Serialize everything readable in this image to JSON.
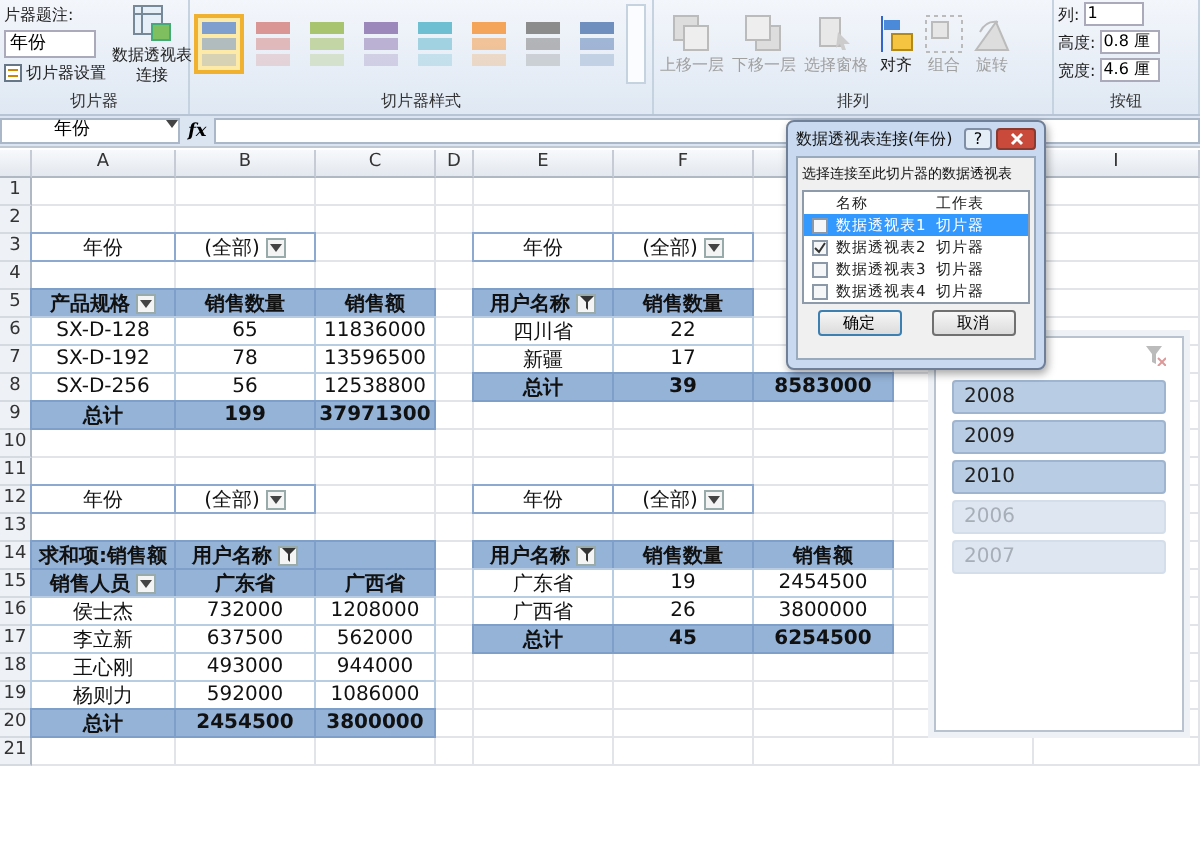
{
  "ribbon": {
    "slicer_group": {
      "caption_label": "片器题注:",
      "caption_value": "年份",
      "settings_button": "切片器设置",
      "connections_button": [
        "数据透视表",
        "连接"
      ],
      "label": "切片器"
    },
    "styles_group": {
      "styles": [
        {
          "color": "#7f9fcf",
          "selected": true
        },
        {
          "color": "#d99694",
          "selected": false
        },
        {
          "color": "#a9c46e",
          "selected": false
        },
        {
          "color": "#9c88bb",
          "selected": false
        },
        {
          "color": "#6fbfd3",
          "selected": false
        },
        {
          "color": "#f5a55a",
          "selected": false
        },
        {
          "color": "#8c8c8c",
          "selected": false
        },
        {
          "color": "#6f8fbf",
          "selected": false
        }
      ],
      "label": "切片器样式"
    },
    "arrange_group": {
      "buttons": [
        {
          "kind": "forward",
          "label": "上移一层",
          "disabled": true
        },
        {
          "kind": "backward",
          "label": "下移一层",
          "disabled": true
        },
        {
          "kind": "pane",
          "label": "选择窗格",
          "disabled": true
        },
        {
          "kind": "align",
          "label": "对齐",
          "disabled": false
        },
        {
          "kind": "group",
          "label": "组合",
          "disabled": true
        },
        {
          "kind": "rotate",
          "label": "旋转",
          "disabled": true
        }
      ],
      "label": "排列"
    },
    "size_group": {
      "fields": [
        {
          "label": "列:",
          "value": "1"
        },
        {
          "label": "高度:",
          "value": "0.8 厘"
        },
        {
          "label": "宽度:",
          "value": "4.6 厘"
        }
      ],
      "label": "按钮"
    }
  },
  "formula_bar": {
    "name_box": "年份",
    "fx": "fx"
  },
  "sheet": {
    "columns": [
      "A",
      "B",
      "C",
      "D",
      "E",
      "F",
      null,
      null,
      "I"
    ],
    "rows": [
      {
        "number": "1",
        "cells": []
      },
      {
        "number": "2",
        "cells": []
      },
      {
        "number": "3",
        "cells": [
          {
            "kind": "filter",
            "text": "年份"
          },
          {
            "kind": "filter",
            "text": "(全部)",
            "dropdown": true
          },
          null,
          null,
          {
            "kind": "filter",
            "text": "年份"
          },
          {
            "kind": "filter",
            "text": "(全部)",
            "dropdown": true
          }
        ]
      },
      {
        "number": "4",
        "cells": []
      },
      {
        "number": "5",
        "cells": [
          {
            "kind": "header",
            "text": "产品规格",
            "dropdown": true
          },
          {
            "kind": "header",
            "text": "销售数量"
          },
          {
            "kind": "header",
            "text": "销售额"
          },
          null,
          {
            "kind": "header",
            "text": "用户名称",
            "filtered": true
          },
          {
            "kind": "header",
            "text": "销售数量"
          }
        ]
      },
      {
        "number": "6",
        "cells": [
          {
            "kind": "body",
            "text": "SX-D-128"
          },
          {
            "kind": "body",
            "text": "65"
          },
          {
            "kind": "body",
            "text": "11836000"
          },
          null,
          {
            "kind": "body",
            "text": "四川省"
          },
          {
            "kind": "body",
            "text": "22"
          }
        ]
      },
      {
        "number": "7",
        "cells": [
          {
            "kind": "body",
            "text": "SX-D-192"
          },
          {
            "kind": "body",
            "text": "78"
          },
          {
            "kind": "body",
            "text": "13596500"
          },
          null,
          {
            "kind": "body",
            "text": "新疆"
          },
          {
            "kind": "body",
            "text": "17"
          }
        ]
      },
      {
        "number": "8",
        "cells": [
          {
            "kind": "body",
            "text": "SX-D-256"
          },
          {
            "kind": "body",
            "text": "56"
          },
          {
            "kind": "body",
            "text": "12538800"
          },
          null,
          {
            "kind": "total",
            "text": "总计"
          },
          {
            "kind": "total",
            "text": "39"
          },
          {
            "kind": "total",
            "text": "8583000"
          }
        ]
      },
      {
        "number": "9",
        "cells": [
          {
            "kind": "total",
            "text": "总计"
          },
          {
            "kind": "total",
            "text": "199"
          },
          {
            "kind": "total",
            "text": "37971300"
          }
        ]
      },
      {
        "number": "10",
        "cells": []
      },
      {
        "number": "11",
        "cells": []
      },
      {
        "number": "12",
        "cells": [
          {
            "kind": "filter",
            "text": "年份"
          },
          {
            "kind": "filter",
            "text": "(全部)",
            "dropdown": true
          },
          null,
          null,
          {
            "kind": "filter",
            "text": "年份"
          },
          {
            "kind": "filter",
            "text": "(全部)",
            "dropdown": true
          }
        ]
      },
      {
        "number": "13",
        "cells": []
      },
      {
        "number": "14",
        "cells": [
          {
            "kind": "header",
            "text": "求和项:销售额"
          },
          {
            "kind": "header",
            "text": "用户名称",
            "filtered": true
          },
          {
            "kind": "header"
          },
          null,
          {
            "kind": "header",
            "text": "用户名称",
            "filtered": true
          },
          {
            "kind": "header",
            "text": "销售数量"
          },
          {
            "kind": "header",
            "text": "销售额"
          }
        ]
      },
      {
        "number": "15",
        "cells": [
          {
            "kind": "header",
            "text": "销售人员",
            "dropdown": true
          },
          {
            "kind": "header",
            "text": "广东省"
          },
          {
            "kind": "header",
            "text": "广西省"
          },
          null,
          {
            "kind": "body",
            "text": "广东省"
          },
          {
            "kind": "body",
            "text": "19"
          },
          {
            "kind": "body",
            "text": "2454500"
          }
        ]
      },
      {
        "number": "16",
        "cells": [
          {
            "kind": "body",
            "text": "侯士杰"
          },
          {
            "kind": "body",
            "text": "732000"
          },
          {
            "kind": "body",
            "text": "1208000"
          },
          null,
          {
            "kind": "body",
            "text": "广西省"
          },
          {
            "kind": "body",
            "text": "26"
          },
          {
            "kind": "body",
            "text": "3800000"
          }
        ]
      },
      {
        "number": "17",
        "cells": [
          {
            "kind": "body",
            "text": "李立新"
          },
          {
            "kind": "body",
            "text": "637500"
          },
          {
            "kind": "body",
            "text": "562000"
          },
          null,
          {
            "kind": "total",
            "text": "总计"
          },
          {
            "kind": "total",
            "text": "45"
          },
          {
            "kind": "total",
            "text": "6254500"
          }
        ]
      },
      {
        "number": "18",
        "cells": [
          {
            "kind": "body",
            "text": "王心刚"
          },
          {
            "kind": "body",
            "text": "493000"
          },
          {
            "kind": "body",
            "text": "944000"
          }
        ]
      },
      {
        "number": "19",
        "cells": [
          {
            "kind": "body",
            "text": "杨则力"
          },
          {
            "kind": "body",
            "text": "592000"
          },
          {
            "kind": "body",
            "text": "1086000"
          }
        ]
      },
      {
        "number": "20",
        "cells": [
          {
            "kind": "total",
            "text": "总计"
          },
          {
            "kind": "total",
            "text": "2454500"
          },
          {
            "kind": "total",
            "text": "3800000"
          }
        ]
      },
      {
        "number": "21",
        "cells": []
      }
    ]
  },
  "slicer": {
    "items": [
      {
        "label": "2008",
        "selected": true
      },
      {
        "label": "2009",
        "selected": true
      },
      {
        "label": "2010",
        "selected": true
      },
      {
        "label": "2006",
        "selected": false
      },
      {
        "label": "2007",
        "selected": false
      }
    ]
  },
  "dialog": {
    "title": "数据透视表连接(年份)",
    "help": "?",
    "prompt": "选择连接至此切片器的数据透视表",
    "columns": [
      "名称",
      "工作表"
    ],
    "tables": [
      {
        "name": "数据透视表1",
        "sheet": "切片器",
        "checked": false,
        "selected": true
      },
      {
        "name": "数据透视表2",
        "sheet": "切片器",
        "checked": true,
        "selected": false
      },
      {
        "name": "数据透视表3",
        "sheet": "切片器",
        "checked": false,
        "selected": false
      },
      {
        "name": "数据透视表4",
        "sheet": "切片器",
        "checked": false,
        "selected": false
      }
    ],
    "buttons": [
      "确定",
      "取消"
    ]
  }
}
